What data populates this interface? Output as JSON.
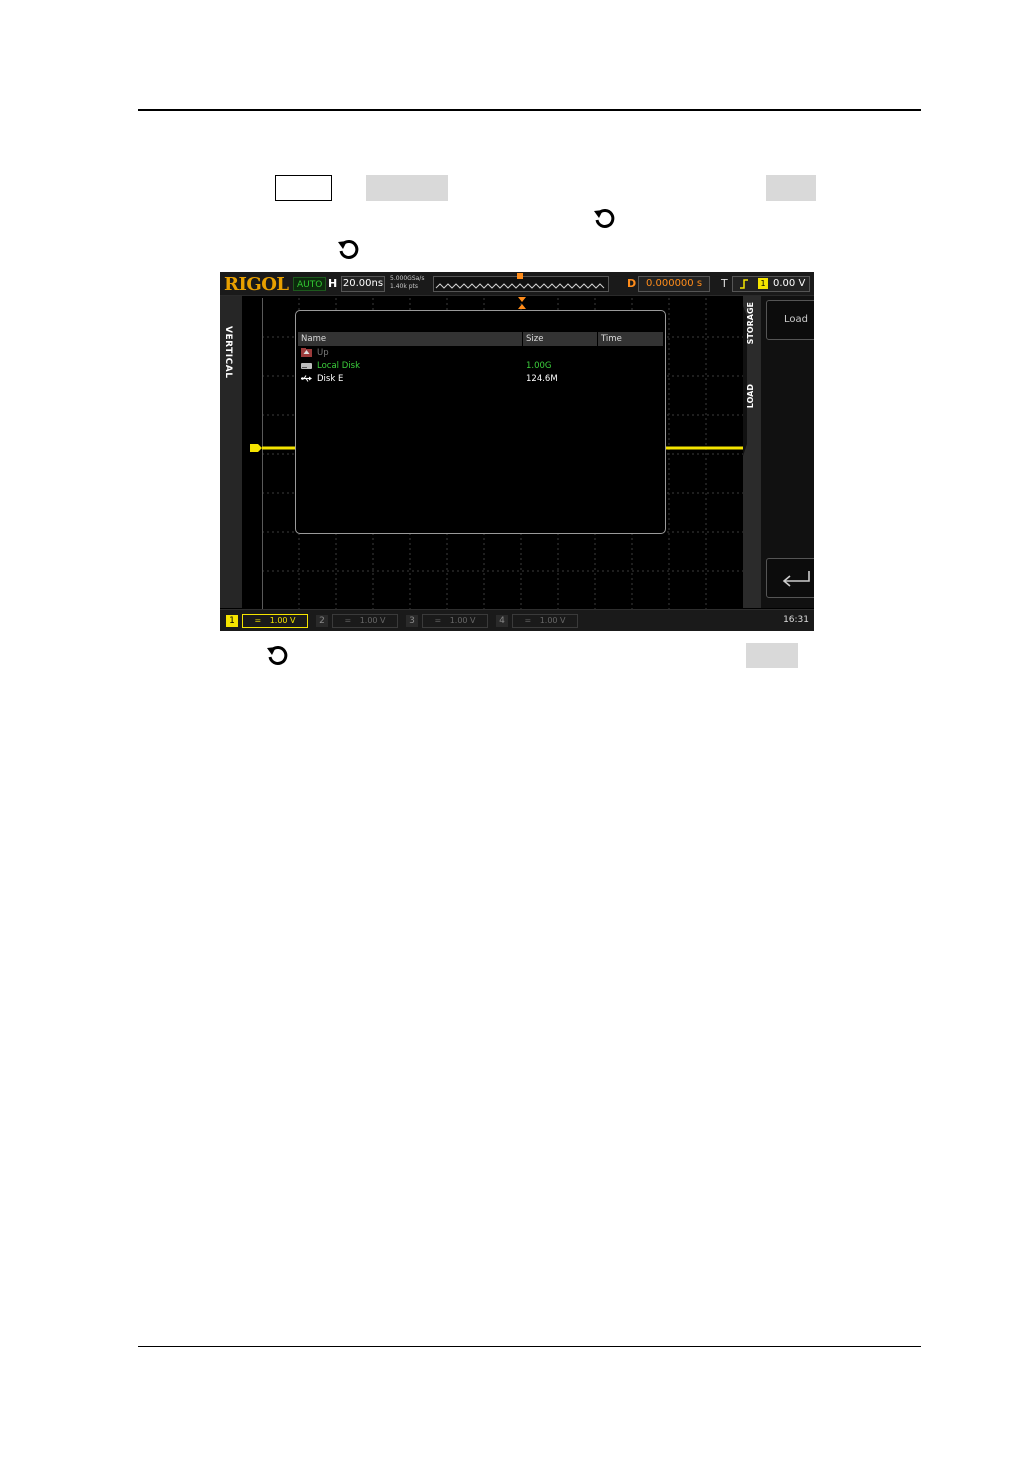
{
  "scope": {
    "brand": "RIGOL",
    "status": "AUTO",
    "horizontal_label": "H",
    "timebase": "20.00ns",
    "sample_rate": "5.000GSa/s",
    "memory_depth": "1.40k pts",
    "delay_label": "D",
    "delay_value": "0.000000 s",
    "trigger_label": "T",
    "trigger_channel": "1",
    "trigger_level": "0.00 V",
    "left_tab": "VERTICAL",
    "menu_tabs": [
      "STORAGE",
      "LOAD"
    ],
    "load_button": "Load",
    "time_display": "16:31",
    "channels": [
      {
        "num": "1",
        "scale": "1.00 V",
        "coupling": "=",
        "active": true
      },
      {
        "num": "2",
        "scale": "1.00 V",
        "coupling": "=",
        "active": false
      },
      {
        "num": "3",
        "scale": "1.00 V",
        "coupling": "=",
        "active": false
      },
      {
        "num": "4",
        "scale": "1.00 V",
        "coupling": "=",
        "active": false
      }
    ]
  },
  "file_dialog": {
    "columns": [
      "Name",
      "Size",
      "Time"
    ],
    "rows": [
      {
        "name": "Up",
        "size": "",
        "icon": "folder-up-icon",
        "color": "#7a7a7a"
      },
      {
        "name": "Local Disk",
        "size": "1.00G",
        "icon": "disk-drive-icon",
        "color": "#3ccf3c"
      },
      {
        "name": "Disk E",
        "size": "124.6M",
        "icon": "usb-icon",
        "color": "#ffffff"
      }
    ]
  },
  "colors": {
    "channel1": "#f5e400",
    "brand": "#e8a000",
    "selected_row": "#3ccf3c",
    "delay": "#ff8c1a"
  }
}
